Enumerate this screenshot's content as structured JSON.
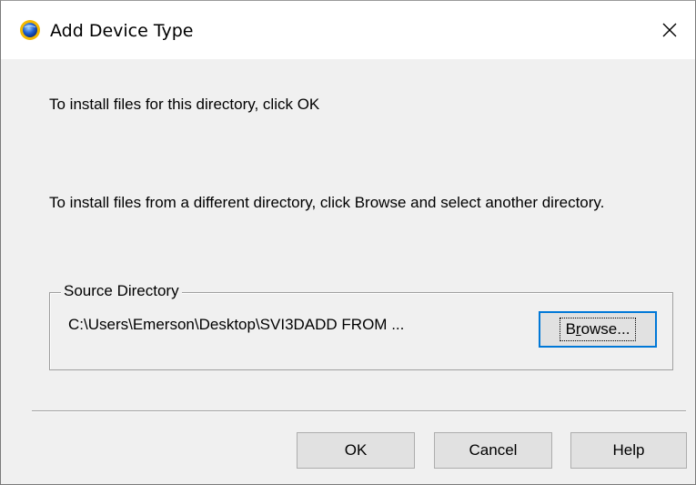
{
  "window": {
    "title": "Add Device Type",
    "close_symbol": "✕",
    "icon": "app-globe-icon"
  },
  "content": {
    "message_ok": "To install files for this directory, click OK",
    "message_browse": "To install files from a different directory, click Browse and select another directory."
  },
  "source_directory": {
    "label": "Source Directory",
    "path": "C:\\Users\\Emerson\\Desktop\\SVI3DADD FROM ...",
    "browse_prefix": "B",
    "browse_accel": "r",
    "browse_rest": "owse..."
  },
  "buttons": {
    "ok": "OK",
    "cancel": "Cancel",
    "help": "Help"
  }
}
